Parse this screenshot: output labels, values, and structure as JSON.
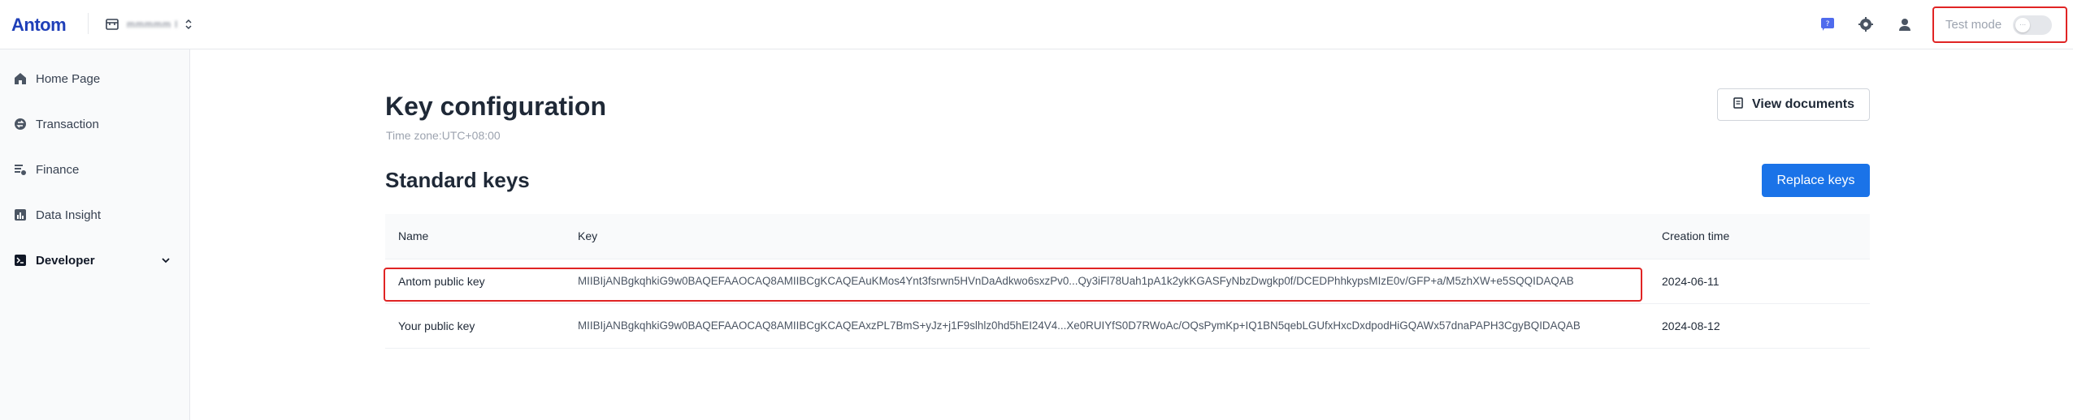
{
  "header": {
    "logo": "Antom",
    "merchant_name": "mmmmm l",
    "test_mode_label": "Test mode",
    "toggle_state": "off"
  },
  "sidebar": {
    "items": [
      {
        "label": "Home Page",
        "icon": "home-icon"
      },
      {
        "label": "Transaction",
        "icon": "transaction-icon"
      },
      {
        "label": "Finance",
        "icon": "finance-icon"
      },
      {
        "label": "Data Insight",
        "icon": "chart-icon"
      },
      {
        "label": "Developer",
        "icon": "terminal-icon",
        "expanded": true
      }
    ]
  },
  "main": {
    "title": "Key configuration",
    "timezone": "Time zone:UTC+08:00",
    "view_docs_label": "View documents",
    "section_title": "Standard keys",
    "replace_keys_label": "Replace keys",
    "table": {
      "headers": [
        "Name",
        "Key",
        "Creation time"
      ],
      "rows": [
        {
          "name": "Antom public key",
          "key": "MIIBIjANBgkqhkiG9w0BAQEFAAOCAQ8AMIIBCgKCAQEAuKMos4Ynt3fsrwn5HVnDaAdkwo6sxzPv0...Qy3iFl78Uah1pA1k2ykKGASFyNbzDwgkp0f/DCEDPhhkypsMIzE0v/GFP+a/M5zhXW+e5SQQIDAQAB",
          "created": "2024-06-11"
        },
        {
          "name": "Your public key",
          "key": "MIIBIjANBgkqhkiG9w0BAQEFAAOCAQ8AMIIBCgKCAQEAxzPL7BmS+yJz+j1F9slhlz0hd5hEI24V4...Xe0RUIYfS0D7RWoAc/OQsPymKp+IQ1BN5qebLGUfxHxcDxdpodHiGQAWx57dnaPAPH3CgyBQIDAQAB",
          "created": "2024-08-12"
        }
      ]
    }
  },
  "colors": {
    "brand": "#1f3fb8",
    "primary_button": "#1a73e8",
    "highlight": "#e02424"
  }
}
